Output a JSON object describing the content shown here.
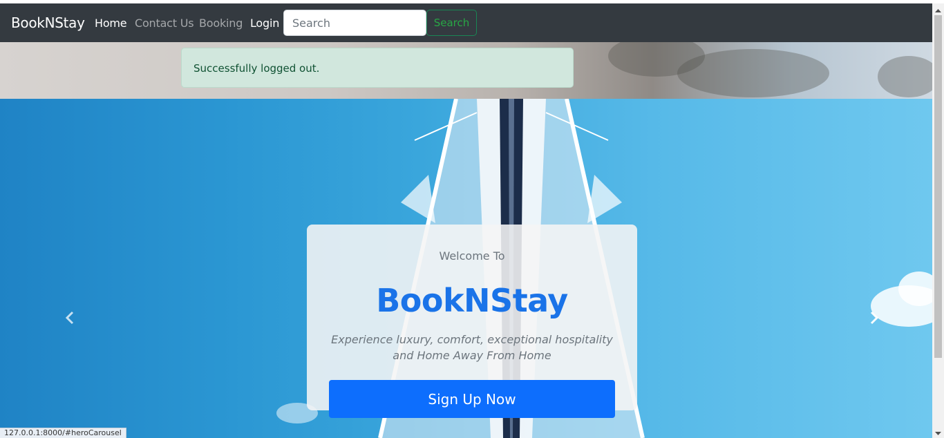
{
  "navbar": {
    "brand": "BookNStay",
    "links": [
      {
        "label": "Home",
        "active": true
      },
      {
        "label": "Contact Us",
        "active": false
      },
      {
        "label": "Booking",
        "active": false
      },
      {
        "label": "Login",
        "active": true
      }
    ],
    "search": {
      "placeholder": "Search",
      "value": "",
      "button_label": "Search"
    }
  },
  "alert": {
    "message": "Successfully logged out."
  },
  "hero": {
    "welcome_text": "Welcome To",
    "title": "BookNStay",
    "tagline": "Experience luxury, comfort, exceptional hospitality and Home Away From Home",
    "cta_label": "Sign Up Now",
    "prev_icon": "chevron-left-icon",
    "next_icon": "chevron-right-icon"
  },
  "status_bar": {
    "url": "127.0.0.1:8000/#heroCarousel"
  },
  "colors": {
    "navbar_bg": "#343a40",
    "alert_bg": "#d1e7dd",
    "alert_text": "#0f5132",
    "primary": "#0d6efd",
    "title_blue": "#1a73e8",
    "search_green": "#198754"
  }
}
